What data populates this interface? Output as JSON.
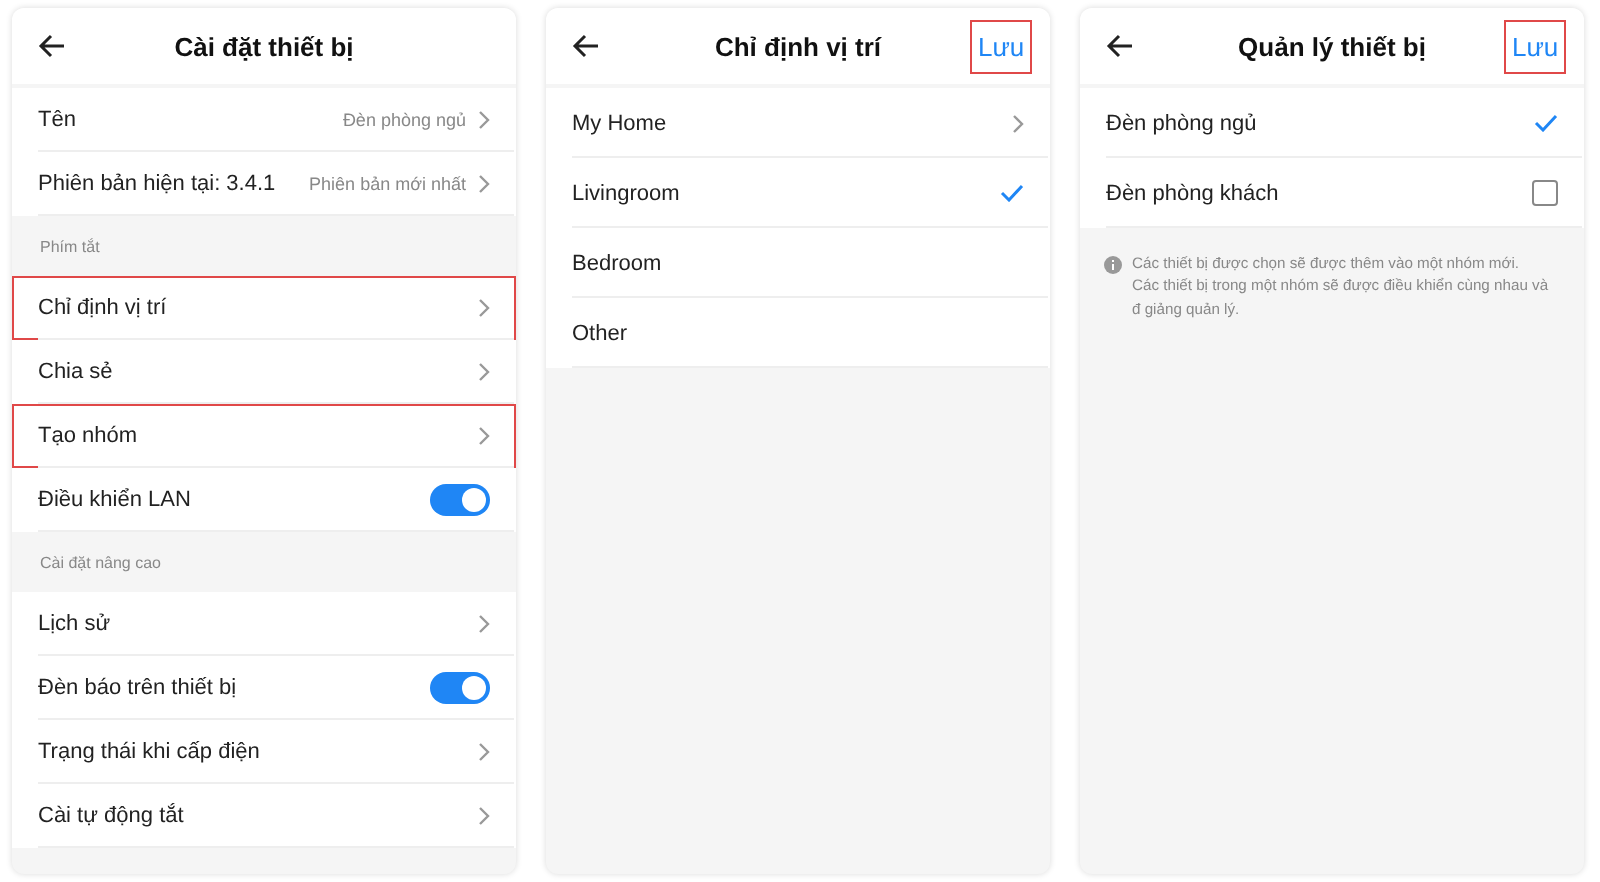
{
  "screens": [
    {
      "kind": "settings",
      "title": "Cài đặt thiết bị",
      "items": [
        {
          "kind": "value",
          "label": "Tên",
          "value": "Đèn phòng ngủ",
          "highlighted": false
        },
        {
          "kind": "value",
          "label": "Phiên bản hiện tại:  3.4.1",
          "value": "Phiên bản mới nhất",
          "highlighted": false
        },
        {
          "kind": "section",
          "label": "Phím tắt"
        },
        {
          "kind": "link",
          "label": "Chỉ định vị trí",
          "highlighted": true
        },
        {
          "kind": "link",
          "label": "Chia sẻ",
          "highlighted": false
        },
        {
          "kind": "link",
          "label": "Tạo nhóm",
          "highlighted": true
        },
        {
          "kind": "toggle",
          "label": "Điều khiển LAN",
          "on": true,
          "highlighted": false
        },
        {
          "kind": "section",
          "label": "Cài đặt nâng cao"
        },
        {
          "kind": "link",
          "label": "Lịch sử",
          "highlighted": false
        },
        {
          "kind": "toggle",
          "label": "Đèn báo trên thiết bị",
          "on": true,
          "highlighted": false
        },
        {
          "kind": "link",
          "label": "Trạng thái khi cấp điện",
          "highlighted": false
        },
        {
          "kind": "link",
          "label": "Cài tự động tắt",
          "highlighted": false
        }
      ]
    },
    {
      "kind": "select",
      "title": "Chỉ định vị trí",
      "save": {
        "label": "Lưu",
        "highlighted": true
      },
      "items": [
        {
          "kind": "link",
          "label": "My Home"
        },
        {
          "kind": "option",
          "label": "Livingroom",
          "selected": true
        },
        {
          "kind": "option",
          "label": "Bedroom",
          "selected": false
        },
        {
          "kind": "option",
          "label": "Other",
          "selected": false
        }
      ]
    },
    {
      "kind": "checklist",
      "title": "Quản lý thiết bị",
      "save": {
        "label": "Lưu",
        "highlighted": true
      },
      "items": [
        {
          "kind": "check",
          "label": "Đèn phòng ngủ",
          "checked": true
        },
        {
          "kind": "check",
          "label": "Đèn phòng khách",
          "checked": false
        }
      ],
      "note": [
        "Các thiết bị được chọn sẽ được thêm vào một nhóm mới.",
        "Các thiết bị trong một nhóm sẽ được điều khiển cùng nhau và đ giảng quản lý."
      ]
    }
  ]
}
